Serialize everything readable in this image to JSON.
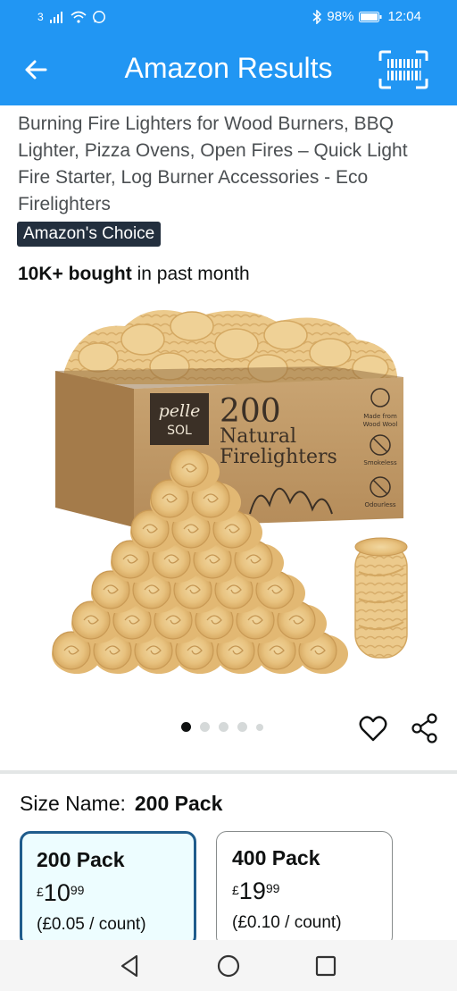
{
  "status_bar": {
    "carrier_label": "3",
    "battery": "98%",
    "time": "12:04",
    "icons": [
      "signal-icon",
      "wifi-icon",
      "whatsapp-icon",
      "bluetooth-icon",
      "battery-icon"
    ]
  },
  "app_bar": {
    "title": "Amazon Results",
    "back_icon": "arrow-left-icon",
    "scan_icon": "barcode-scanner-icon"
  },
  "product": {
    "title": "Burning Fire Lighters for Wood Burners, BBQ Lighter, Pizza Ovens, Open Fires – Quick Light Fire Starter, Log Burner Accessories - Eco Firelighters",
    "badge": "Amazon's Choice",
    "bought_bold": "10K+ bought",
    "bought_rest": " in past month",
    "image": {
      "brand_line1": "pelle",
      "brand_line2": "SOL",
      "box_number": "200",
      "box_line1": "Natural",
      "box_line2": "Firelighters",
      "feature1_line1": "Made from",
      "feature1_line2": "Wood Wool",
      "feature2": "Smokeless",
      "feature3": "Odourless"
    },
    "carousel": {
      "count": 5,
      "active": 1
    }
  },
  "size": {
    "label": "Size Name:",
    "selected": "200 Pack",
    "options": [
      {
        "name": "200 Pack",
        "currency": "£",
        "whole": "10",
        "fraction": "99",
        "unit_price": "(£0.05 / count)",
        "selected": true
      },
      {
        "name": "400 Pack",
        "currency": "£",
        "whole": "19",
        "fraction": "99",
        "unit_price": "(£0.10 / count)",
        "selected": false
      }
    ]
  },
  "nav_bar": {
    "icons": [
      "back-triangle-icon",
      "home-circle-icon",
      "recents-square-icon"
    ]
  },
  "colors": {
    "app_blue": "#2196f3",
    "badge_bg": "#232f3e",
    "selected_card_border": "#1f5c8c",
    "selected_card_bg": "#edfdff"
  }
}
